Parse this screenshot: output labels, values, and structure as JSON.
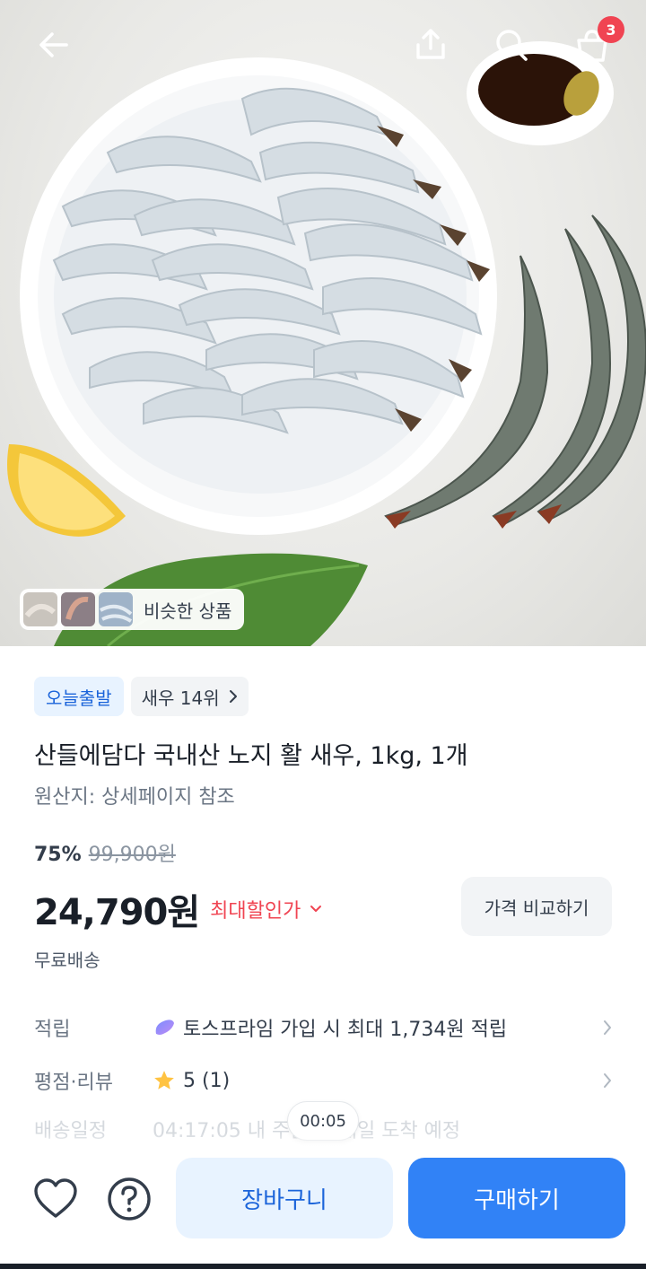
{
  "header": {
    "back_icon": "arrow-left-icon",
    "share_icon": "share-icon",
    "search_icon": "search-icon",
    "cart_icon": "shopping-bag-icon",
    "cart_count": "3"
  },
  "hero": {
    "similar_label": "비슷한 상품"
  },
  "product": {
    "tag_today": "오늘출발",
    "tag_rank": "새우 14위",
    "title": "산들에담다 국내산 노지 활 새우, 1kg, 1개",
    "origin": "원산지: 상세페이지 참조",
    "discount_rate": "75%",
    "original_price": "99,900원",
    "price": "24,790원",
    "lowest_label": "최대할인가",
    "compare_label": "가격 비교하기",
    "shipping": "무료배송"
  },
  "info": {
    "points_label": "적립",
    "points_value": "토스프라임 가입 시 최대 1,734원 적립",
    "rating_label": "평점·리뷰",
    "rating_value": "5 (1)",
    "delivery_label": "배송일정",
    "delivery_value": "04:17:05 내 주문 시 내일 도착 예정"
  },
  "timer": "00:05",
  "bottom": {
    "cart_button": "장바구니",
    "buy_button": "구매하기"
  },
  "colors": {
    "accent": "#3182f6",
    "accent_light": "#e8f3ff",
    "discount_red": "#f04452",
    "text_dark": "#191f28"
  }
}
